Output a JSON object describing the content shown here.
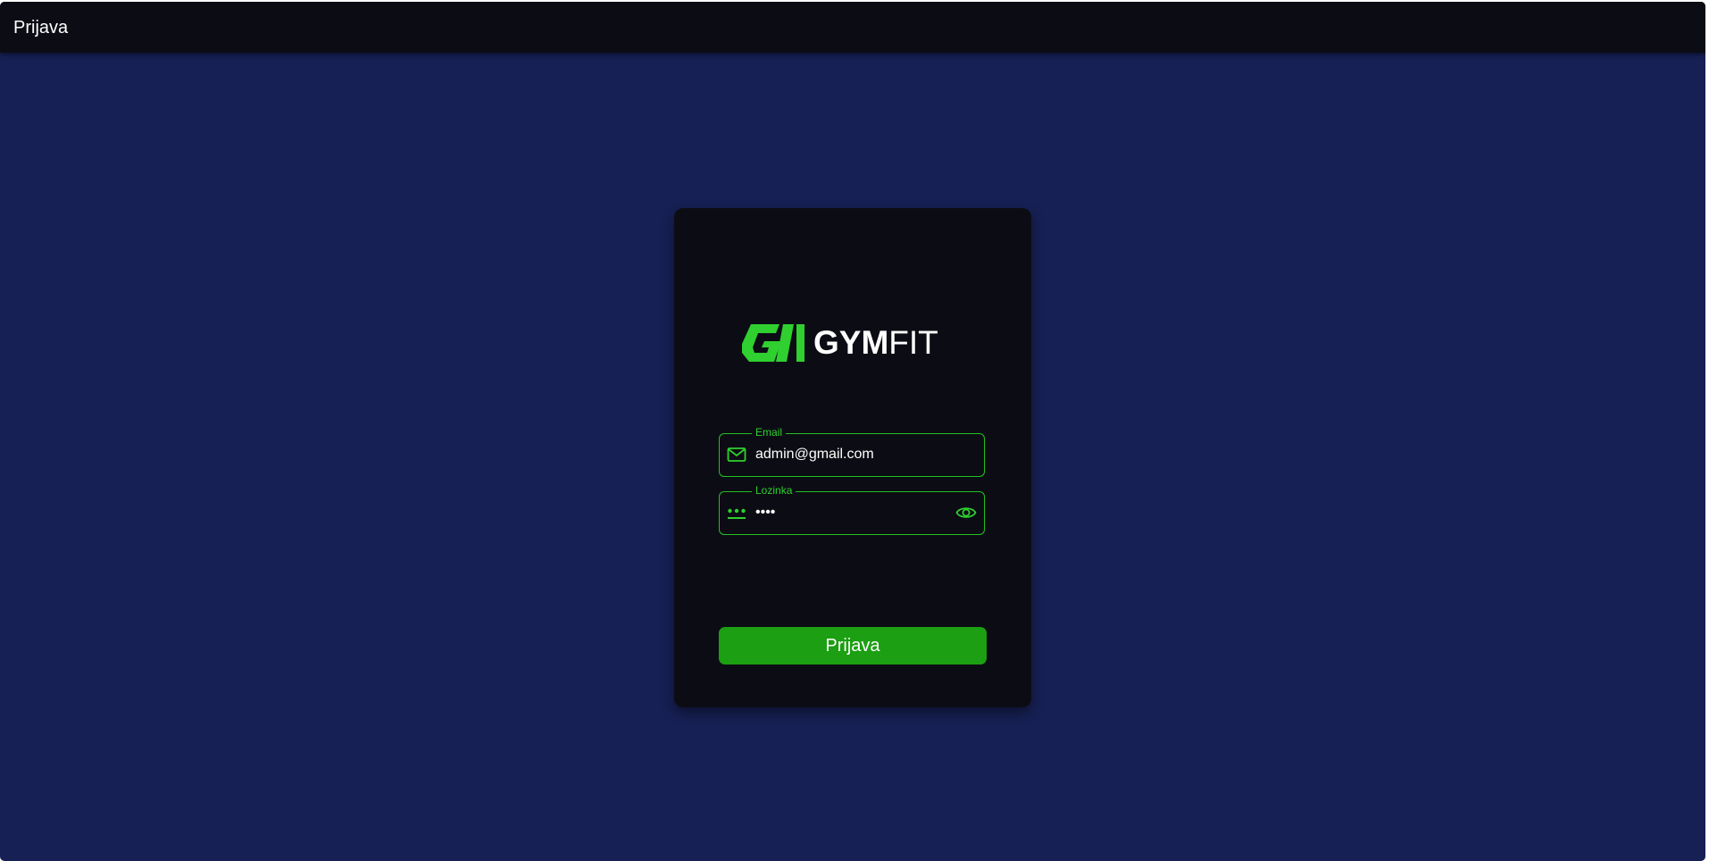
{
  "header": {
    "title": "Prijava"
  },
  "logo": {
    "text_bold": "GYM",
    "text_light": "FIT",
    "mark_color": "#2fd02f"
  },
  "form": {
    "email": {
      "label": "Email",
      "value": "admin@gmail.com",
      "icon": "mail-icon"
    },
    "password": {
      "label": "Lozinka",
      "value": "••••",
      "icon": "password-icon",
      "toggle_icon": "eye-icon"
    },
    "submit_label": "Prijava"
  },
  "colors": {
    "background": "#172054",
    "topbar": "#0b0c14",
    "card": "#0c0d14",
    "accent": "#22c022",
    "button": "#1c9f12"
  }
}
